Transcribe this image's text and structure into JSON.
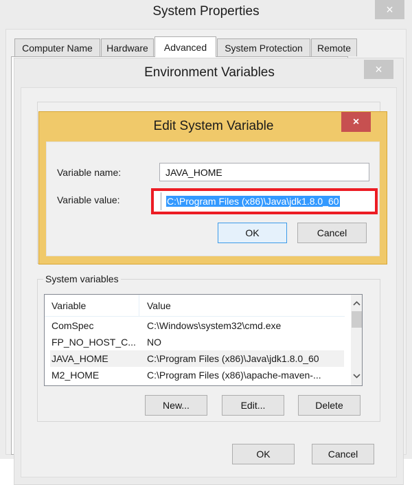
{
  "system_properties": {
    "title": "System Properties",
    "close_icon": "×",
    "tabs": [
      {
        "label": "Computer Name",
        "active": false
      },
      {
        "label": "Hardware",
        "active": false
      },
      {
        "label": "Advanced",
        "active": true
      },
      {
        "label": "System Protection",
        "active": false
      },
      {
        "label": "Remote",
        "active": false
      }
    ]
  },
  "environment_variables": {
    "title": "Environment Variables",
    "close_icon": "×",
    "system_variables": {
      "legend": "System variables",
      "columns": [
        "Variable",
        "Value"
      ],
      "rows": [
        {
          "variable": "ComSpec",
          "value": "C:\\Windows\\system32\\cmd.exe",
          "selected": false
        },
        {
          "variable": "FP_NO_HOST_C...",
          "value": "NO",
          "selected": false
        },
        {
          "variable": "JAVA_HOME",
          "value": "C:\\Program Files (x86)\\Java\\jdk1.8.0_60",
          "selected": true
        },
        {
          "variable": "M2_HOME",
          "value": "C:\\Program Files (x86)\\apache-maven-...",
          "selected": false
        }
      ],
      "scroll_up_icon": "⌃",
      "scroll_down_icon": "⌄",
      "buttons": {
        "new": "New...",
        "edit": "Edit...",
        "delete": "Delete"
      }
    },
    "buttons": {
      "ok": "OK",
      "cancel": "Cancel"
    }
  },
  "edit_system_variable": {
    "title": "Edit System Variable",
    "close_icon": "×",
    "name_label": "Variable name:",
    "name_value": "JAVA_HOME",
    "value_label": "Variable value:",
    "value_value": "C:\\Program Files (x86)\\Java\\jdk1.8.0_60",
    "highlight_color": "#ec1c24",
    "buttons": {
      "ok": "OK",
      "cancel": "Cancel"
    }
  }
}
